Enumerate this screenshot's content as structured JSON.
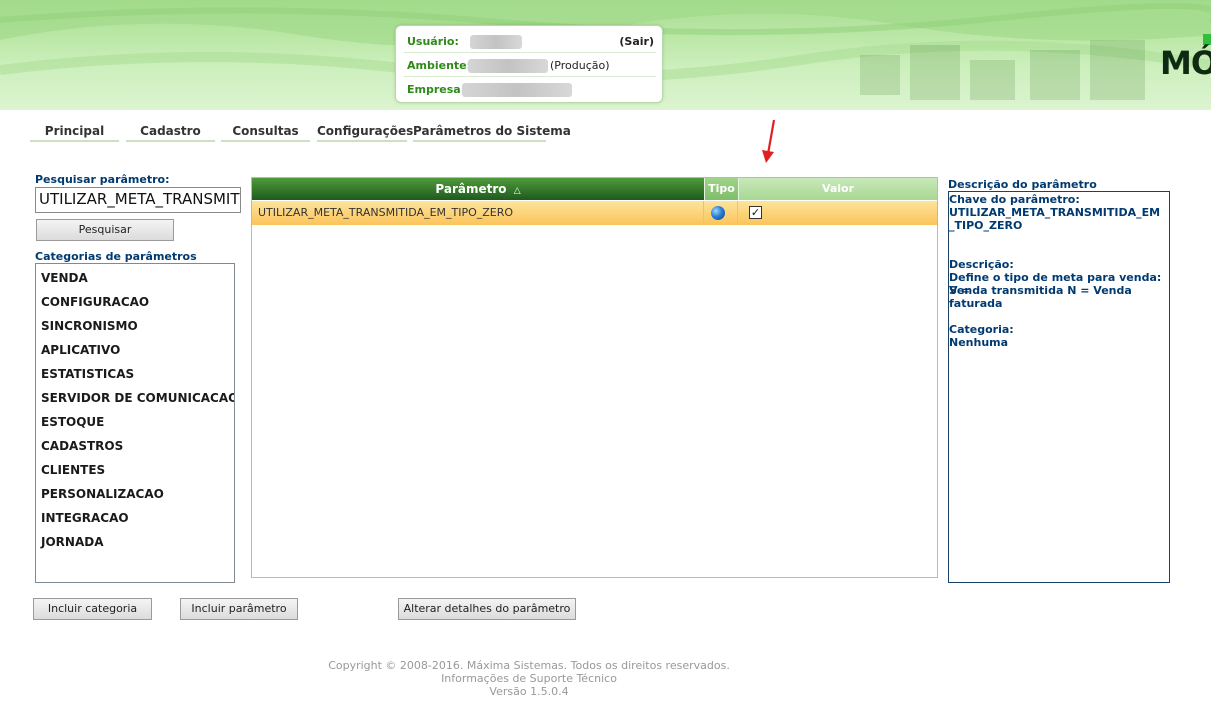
{
  "header": {
    "user_label": "Usuário:",
    "logout_label": "(Sair)",
    "environment_label": "Ambiente:",
    "environment_suffix": "(Produção)",
    "company_label": "Empresa:",
    "logo_text": "MÓ"
  },
  "nav": {
    "items": [
      {
        "label": "Principal"
      },
      {
        "label": "Cadastro"
      },
      {
        "label": "Consultas"
      },
      {
        "label": "Configurações"
      },
      {
        "label": "Parâmetros do Sistema"
      }
    ]
  },
  "search": {
    "label": "Pesquisar parâmetro:",
    "value": "UTILIZAR_META_TRANSMITIDA_EM_TIPO_ZERO",
    "button_label": "Pesquisar"
  },
  "categories": {
    "label": "Categorias de parâmetros",
    "items": [
      "VENDA",
      "CONFIGURACAO",
      "SINCRONISMO",
      "APLICATIVO",
      "ESTATISTICAS",
      "SERVIDOR DE COMUNICACAO",
      "ESTOQUE",
      "CADASTROS",
      "CLIENTES",
      "PERSONALIZACAO",
      "INTEGRACAO",
      "JORNADA"
    ]
  },
  "grid": {
    "columns": {
      "param": "Parâmetro",
      "sort_indicator": "△",
      "type": "Tipo",
      "value": "Valor"
    },
    "rows": [
      {
        "name": "UTILIZAR_META_TRANSMITIDA_EM_TIPO_ZERO",
        "type_icon": "globe-icon",
        "value_checked": true,
        "check_mark": "✓"
      }
    ]
  },
  "description": {
    "label": "Descrição do parâmetro",
    "key_label": "Chave do parâmetro:",
    "key_value_line1": "UTILIZAR_META_TRANSMITIDA_EM",
    "key_value_line2": "_TIPO_ZERO",
    "desc_label": "Descrição:",
    "desc_line1": "Define o tipo de meta para venda: S =",
    "desc_line2": "Venda transmitida N = Venda faturada",
    "category_label": "Categoria:",
    "category_value": "Nenhuma"
  },
  "buttons": {
    "add_category": "Incluir categoria",
    "add_parameter": "Incluir parâmetro",
    "edit_parameter": "Alterar detalhes do parâmetro"
  },
  "footer": {
    "copyright": "Copyright © 2008-2016. Máxima Sistemas. Todos os direitos reservados.",
    "support": "Informações de Suporte Técnico",
    "version": "Versão 1.5.0.4"
  },
  "colors": {
    "header_green": "#b9e6a4",
    "label_green": "#2f8a1a",
    "grid_header_dark": "#1f5a1c",
    "selected_row": "#fbc45a",
    "label_blue": "#003a70",
    "arrow_red": "#e02020"
  }
}
